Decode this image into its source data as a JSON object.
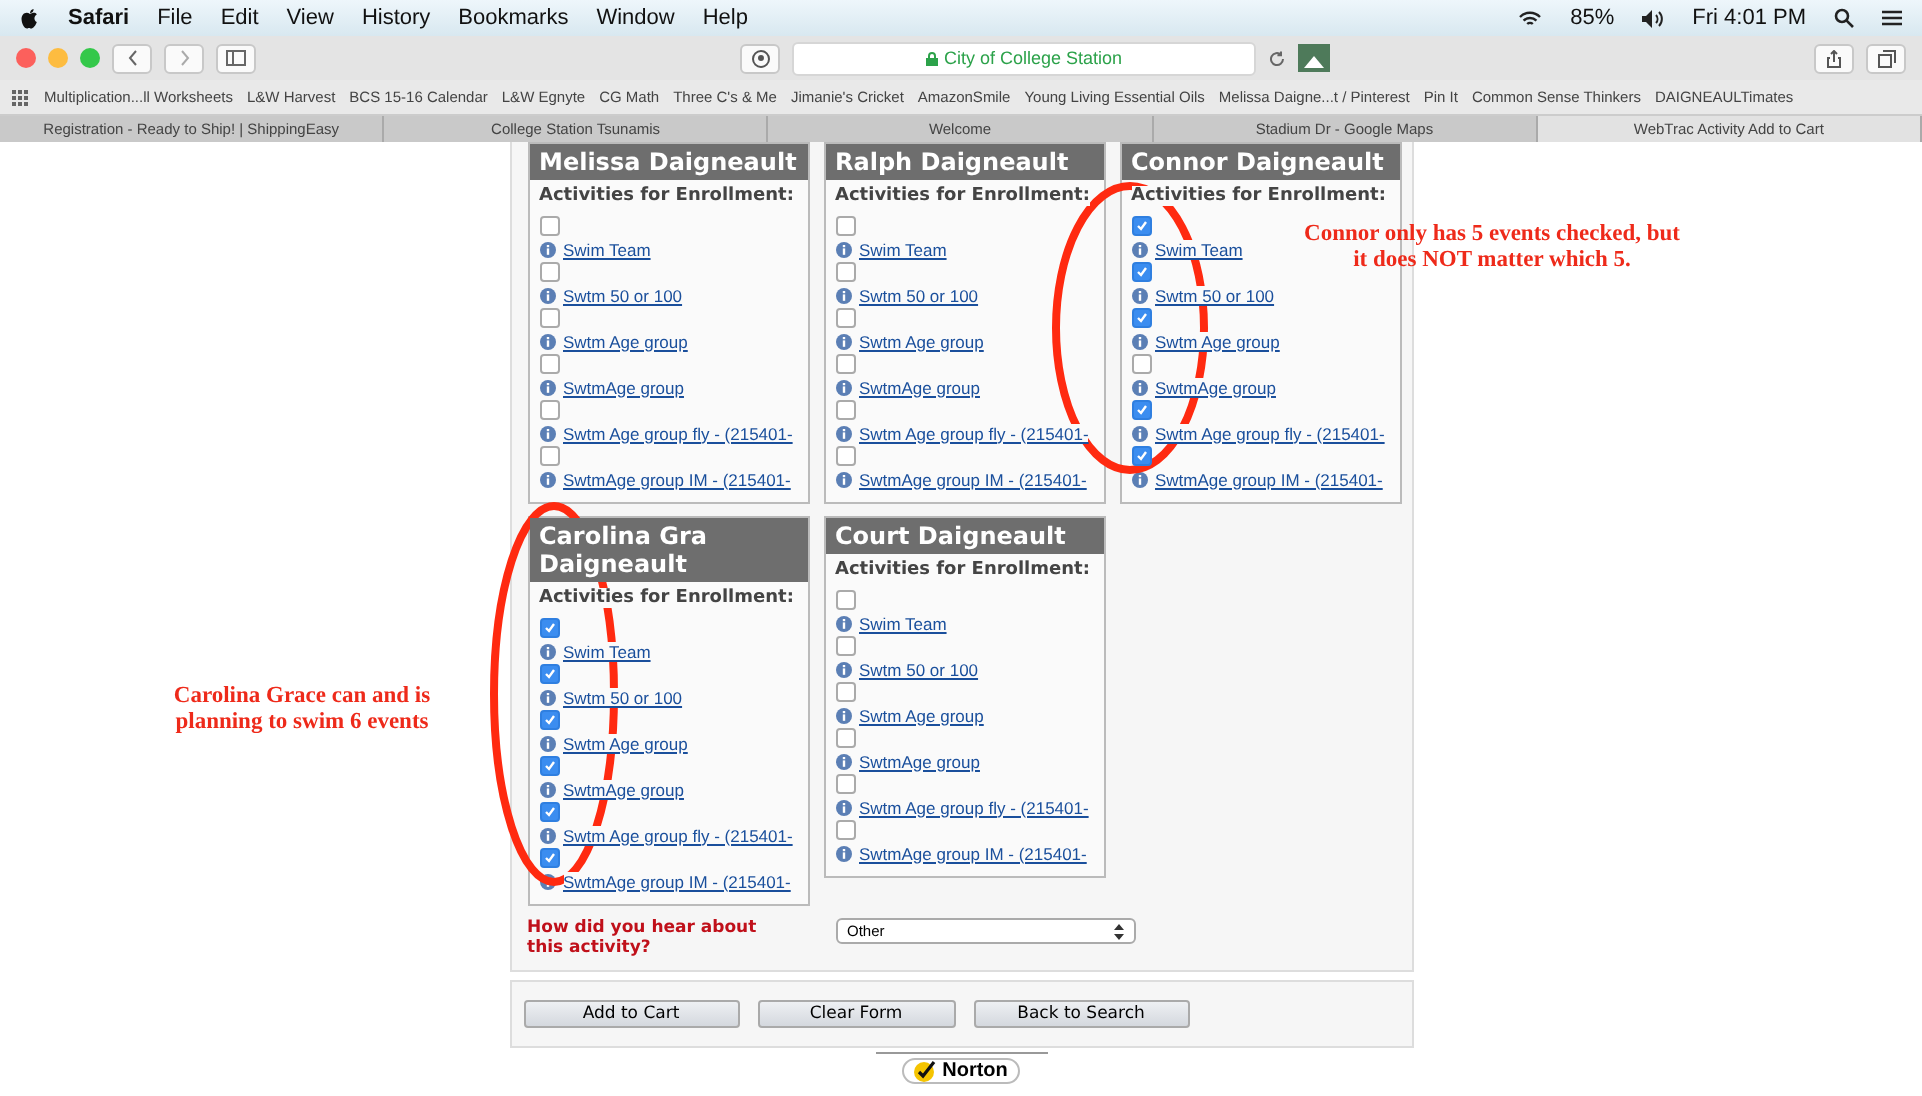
{
  "menubar": {
    "app": "Safari",
    "items": [
      "File",
      "Edit",
      "View",
      "History",
      "Bookmarks",
      "Window",
      "Help"
    ],
    "battery": "85%",
    "clock": "Fri 4:01 PM"
  },
  "toolbar": {
    "address": "City of College Station",
    "secure": true
  },
  "bookmarks": [
    "Multiplication...ll Worksheets",
    "L&W Harvest",
    "BCS 15-16 Calendar",
    "L&W Egnyte",
    "CG Math",
    "Three C's & Me",
    "Jimanie's Cricket",
    "AmazonSmile",
    "Young Living Essential Oils",
    "Melissa Daigne...t / Pinterest",
    "Pin It",
    "Common Sense Thinkers",
    "DAIGNEAULTimates"
  ],
  "tabs": [
    {
      "label": "Registration - Ready to Ship! | ShippingEasy",
      "selected": false
    },
    {
      "label": "College Station Tsunamis",
      "selected": false
    },
    {
      "label": "Welcome",
      "selected": false
    },
    {
      "label": "Stadium Dr - Google Maps",
      "selected": false
    },
    {
      "label": "WebTrac Activity Add to Cart",
      "selected": true
    }
  ],
  "people": [
    {
      "name": "Melissa Daigneault",
      "heading": "Activities for Enrollment:",
      "activities": [
        {
          "label": "Swim Team",
          "checked": false
        },
        {
          "label": "Swtm 50 or 100",
          "checked": false
        },
        {
          "label": "Swtm Age group",
          "checked": false
        },
        {
          "label": "SwtmAge group",
          "checked": false
        },
        {
          "label": "Swtm Age group fly - (215401-",
          "checked": false
        },
        {
          "label": "SwtmAge group IM - (215401-",
          "checked": false
        }
      ]
    },
    {
      "name": "Ralph Daigneault",
      "heading": "Activities for Enrollment:",
      "activities": [
        {
          "label": "Swim Team",
          "checked": false
        },
        {
          "label": "Swtm 50 or 100",
          "checked": false
        },
        {
          "label": "Swtm Age group",
          "checked": false
        },
        {
          "label": "SwtmAge group",
          "checked": false
        },
        {
          "label": "Swtm Age group fly - (215401-",
          "checked": false
        },
        {
          "label": "SwtmAge group IM - (215401-",
          "checked": false
        }
      ]
    },
    {
      "name": "Connor Daigneault",
      "heading": "Activities for Enrollment:",
      "activities": [
        {
          "label": "Swim Team",
          "checked": true
        },
        {
          "label": "Swtm 50 or 100",
          "checked": true
        },
        {
          "label": "Swtm Age group",
          "checked": true
        },
        {
          "label": "SwtmAge group",
          "checked": false
        },
        {
          "label": "Swtm Age group fly - (215401-",
          "checked": true
        },
        {
          "label": "SwtmAge group IM - (215401-",
          "checked": true
        }
      ]
    },
    {
      "name": "Carolina Gra Daigneault",
      "heading": "Activities for Enrollment:",
      "activities": [
        {
          "label": "Swim Team",
          "checked": true
        },
        {
          "label": "Swtm 50 or 100",
          "checked": true
        },
        {
          "label": "Swtm Age group",
          "checked": true
        },
        {
          "label": "SwtmAge group",
          "checked": true
        },
        {
          "label": "Swtm Age group fly - (215401-",
          "checked": true
        },
        {
          "label": "SwtmAge group IM - (215401-",
          "checked": true
        }
      ]
    },
    {
      "name": "Court Daigneault",
      "heading": "Activities for Enrollment:",
      "activities": [
        {
          "label": "Swim Team",
          "checked": false
        },
        {
          "label": "Swtm 50 or 100",
          "checked": false
        },
        {
          "label": "Swtm Age group",
          "checked": false
        },
        {
          "label": "SwtmAge group",
          "checked": false
        },
        {
          "label": "Swtm Age group fly - (215401-",
          "checked": false
        },
        {
          "label": "SwtmAge group IM - (215401-",
          "checked": false
        }
      ]
    }
  ],
  "question": {
    "label": "How did you hear about this activity?",
    "value": "Other"
  },
  "buttons": [
    "Add to Cart",
    "Clear Form",
    "Back to Search"
  ],
  "badge": "Norton",
  "annotations": [
    "Connor only has 5 events checked, but it does NOT matter which 5.",
    "Carolina Grace can and is planning to swim 6 events"
  ]
}
